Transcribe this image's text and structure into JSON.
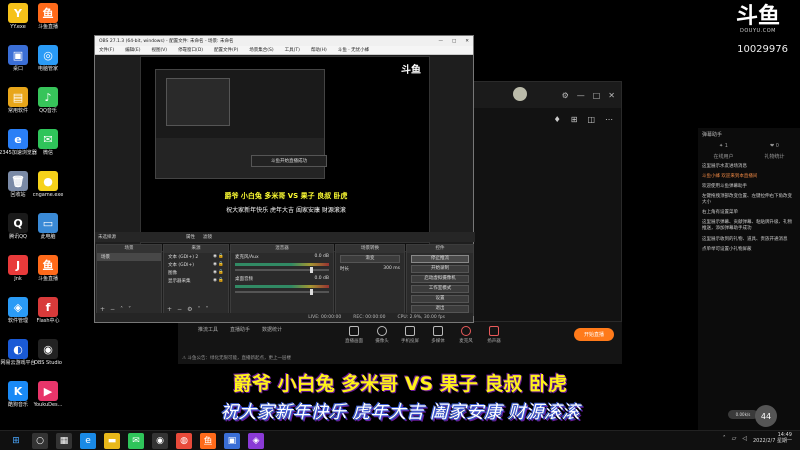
{
  "desktop_icons": [
    {
      "label": "YY.exe",
      "color": "#f6c21a",
      "glyph": "Y"
    },
    {
      "label": "斗鱼直播",
      "color": "#ff6a1a",
      "glyph": "鱼"
    },
    {
      "label": "桌口",
      "color": "#3a6ed6",
      "glyph": "▣"
    },
    {
      "label": "电脑管家",
      "color": "#2a9bf6",
      "glyph": "◎"
    },
    {
      "label": "常用软件",
      "color": "#e8a61a",
      "glyph": "▤"
    },
    {
      "label": "QQ音乐",
      "color": "#37c45a",
      "glyph": "♪"
    },
    {
      "label": "2345加速浏览器",
      "color": "#2a7ff6",
      "glyph": "e"
    },
    {
      "label": "微信",
      "color": "#2fc45a",
      "glyph": "✉"
    },
    {
      "label": "回收站",
      "color": "#7a8aa6",
      "glyph": "🗑"
    },
    {
      "label": "cngame.exe",
      "color": "#f6d21a",
      "glyph": "●"
    },
    {
      "label": "腾讯QQ",
      "color": "#1a1a1a",
      "glyph": "Q"
    },
    {
      "label": "此电脑",
      "color": "#3a8ad6",
      "glyph": "▭"
    },
    {
      "label": "Jnk",
      "color": "#e83a3a",
      "glyph": "J"
    },
    {
      "label": "斗鱼直播",
      "color": "#ff6a1a",
      "glyph": "鱼"
    },
    {
      "label": "软件管理",
      "color": "#2a9bf6",
      "glyph": "◈"
    },
    {
      "label": "Flash中心",
      "color": "#d83a3a",
      "glyph": "f"
    },
    {
      "label": "网易云游戏平台",
      "color": "#1a5ad6",
      "glyph": "◐"
    },
    {
      "label": "OBS Studio",
      "color": "#222222",
      "glyph": "◉"
    },
    {
      "label": "酷狗音乐",
      "color": "#1a8af6",
      "glyph": "K"
    },
    {
      "label": "YoukuDes...",
      "color": "#e8356a",
      "glyph": "▶"
    }
  ],
  "douyu": {
    "logo_text": "斗鱼",
    "logo_url": "DOUYU.COM",
    "room_id": "10029976"
  },
  "obs": {
    "title": "OBS 27.1.3 (64-bit, windows) - 配置文件: 未命名 - 场景: 未命名",
    "menu": [
      "文件(F)",
      "编辑(E)",
      "视图(V)",
      "停靠窗口(D)",
      "配置文件(P)",
      "场景集合(S)",
      "工具(T)",
      "帮助(H)",
      "斗鱼 · 无忧小蜂"
    ],
    "no_source_label": "未选择源",
    "properties_label": "属性",
    "filters_label": "滤镜",
    "scenes_title": "场景",
    "scenes": [
      "场景"
    ],
    "sources_title": "来源",
    "sources": [
      "文本 (GDI+) 2",
      "文本 (GDI+)",
      "图像",
      "显示器采集"
    ],
    "mixer_title": "混音器",
    "mixer_tracks": [
      {
        "name": "麦克风/Aux",
        "level": "0.0 dB"
      },
      {
        "name": "桌面音频",
        "level": "0.0 dB"
      }
    ],
    "transitions_title": "场景转换",
    "transition_value": "渐变",
    "duration_label": "时长",
    "duration_value": "300 ms",
    "controls_title": "控件",
    "controls": [
      "停止推流",
      "开始录制",
      "启动虚拟摄像机",
      "工作室模式",
      "设置",
      "退出"
    ],
    "status": {
      "live": "LIVE: 00:00:00",
      "rec": "REC: 00:00:00",
      "cpu": "CPU: 2.9%, 30.00 fps"
    },
    "preview_dialog": "斗鱼开始直播成功",
    "window_controls": [
      "—",
      "□",
      "✕"
    ]
  },
  "companion": {
    "header_buttons": [
      "⚙",
      "—",
      "□",
      "✕"
    ],
    "toolbar": [
      "♦",
      "⊞",
      "◫",
      "⋯"
    ],
    "bottom_tabs": [
      "推流工具",
      "直播助手",
      "数据统计"
    ],
    "tools": [
      {
        "label": "直播画面"
      },
      {
        "label": "摄像头"
      },
      {
        "label": "手机投屏"
      },
      {
        "label": "多媒体"
      },
      {
        "label": "麦克风"
      },
      {
        "label": "扬声器"
      }
    ],
    "start_button": "开始直播",
    "notice": "⚠ 斗鱼公告：绿化无限可能，直播新起点，更上一层楼"
  },
  "chat": {
    "title": "弹幕助手",
    "stats": [
      "✦ 1",
      "❤ 0"
    ],
    "sub": [
      "在线用户",
      "礼物统计"
    ],
    "lines": [
      {
        "text": "这里展示水友进场消息",
        "fans": false
      },
      {
        "text": "斗鱼小蜂 欢迎来到本直播间",
        "fans": true
      },
      {
        "text": "欢迎使用斗鱼弹幕助手",
        "fans": false
      },
      {
        "text": "左键拖拽顶部改变位置、左键拉伸右下角改变大小",
        "fans": false
      },
      {
        "text": "右上角有设置菜单",
        "fans": false
      },
      {
        "text": "这里展示弹幕、贡献弹幕、粘贴牌升级、礼物推送，添加弹幕助手成功",
        "fans": false
      },
      {
        "text": "这里展示收到的礼物、道具、贵族开通消息",
        "fans": false
      },
      {
        "text": "点单举可设置小礼物屏蔽",
        "fans": false
      }
    ],
    "viewer_count": "44",
    "speed_pill": "0.00k/s"
  },
  "overlay": {
    "line1": "爵爷  小白兔  多米哥  VS  果子  良叔  卧虎",
    "line2": "祝大家新年快乐   虎年大吉   阖家安康    财源滚滚"
  },
  "preview": {
    "logo": "斗鱼",
    "line1": "爵爷 小白兔 多米哥 VS 果子 良叔 卧虎",
    "line2": "祝大家新年快乐  虎年大吉  阖家安康  财源滚滚"
  },
  "taskbar": {
    "start_icon": "⊞",
    "apps": [
      {
        "name": "search",
        "glyph": "○",
        "color": "#333333"
      },
      {
        "name": "task-view",
        "glyph": "▦",
        "color": "#333333"
      },
      {
        "name": "edge",
        "glyph": "e",
        "color": "#1a8ae6"
      },
      {
        "name": "explorer",
        "glyph": "▬",
        "color": "#e8b81a"
      },
      {
        "name": "wechat",
        "glyph": "✉",
        "color": "#2fc45a"
      },
      {
        "name": "obs",
        "glyph": "◉",
        "color": "#333333"
      },
      {
        "name": "chrome",
        "glyph": "◍",
        "color": "#e84a3a"
      },
      {
        "name": "douyu",
        "glyph": "鱼",
        "color": "#ff6a1a"
      },
      {
        "name": "app",
        "glyph": "▣",
        "color": "#3a6ed6"
      },
      {
        "name": "app2",
        "glyph": "◈",
        "color": "#8a3ad6"
      }
    ],
    "time": "14:49",
    "date": "2022/2/7 星期一"
  }
}
